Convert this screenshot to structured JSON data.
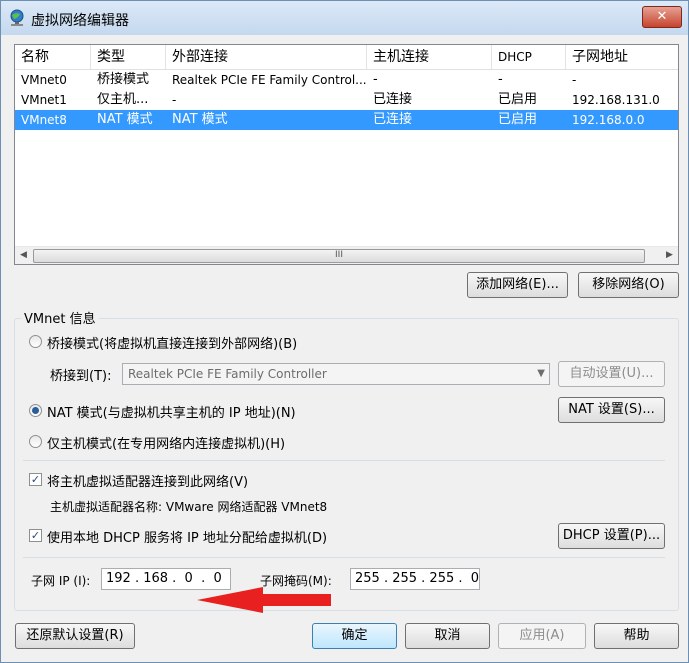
{
  "window": {
    "title": "虚拟网络编辑器",
    "close_label": "✕"
  },
  "columns": [
    "名称",
    "类型",
    "外部连接",
    "主机连接",
    "DHCP",
    "子网地址"
  ],
  "networks": [
    {
      "name": "VMnet0",
      "type": "桥接模式",
      "external": "Realtek PCIe FE Family Control...",
      "host": "-",
      "dhcp": "-",
      "subnet": "-"
    },
    {
      "name": "VMnet1",
      "type": "仅主机...",
      "external": "-",
      "host": "已连接",
      "dhcp": "已启用",
      "subnet": "192.168.131.0"
    },
    {
      "name": "VMnet8",
      "type": "NAT 模式",
      "external": "NAT 模式",
      "host": "已连接",
      "dhcp": "已启用",
      "subnet": "192.168.0.0"
    }
  ],
  "selected_row": 2,
  "scrollbar": {
    "left": "◀",
    "right": "▶",
    "grip": "III"
  },
  "list_buttons": {
    "add": "添加网络(E)...",
    "remove": "移除网络(O)"
  },
  "info": {
    "group_title": "VMnet 信息",
    "bridge_radio": "桥接模式(将虚拟机直接连接到外部网络)(B)",
    "bridge_to_label": "桥接到(T):",
    "bridge_adapter": "Realtek PCIe FE Family Controller",
    "auto_button": "自动设置(U)...",
    "nat_radio": "NAT 模式(与虚拟机共享主机的 IP 地址)(N)",
    "nat_button": "NAT 设置(S)...",
    "hostonly_radio": "仅主机模式(在专用网络内连接虚拟机)(H)",
    "connect_adapter_check": "将主机虚拟适配器连接到此网络(V)",
    "adapter_name_label": "主机虚拟适配器名称: VMware 网络适配器 VMnet8",
    "dhcp_check": "使用本地 DHCP 服务将 IP 地址分配给虚拟机(D)",
    "dhcp_button": "DHCP 设置(P)...",
    "subnet_ip_label": "子网 IP (I):",
    "subnet_ip_value": "192 . 168 .  0  .  0",
    "subnet_mask_label": "子网掩码(M):",
    "subnet_mask_value": "255 . 255 . 255 .  0"
  },
  "footer": {
    "restore": "还原默认设置(R)",
    "ok": "确定",
    "cancel": "取消",
    "apply": "应用(A)",
    "help": "帮助"
  },
  "colors": {
    "selection": "#3399ff",
    "annotation_arrow": "#e8201f"
  }
}
